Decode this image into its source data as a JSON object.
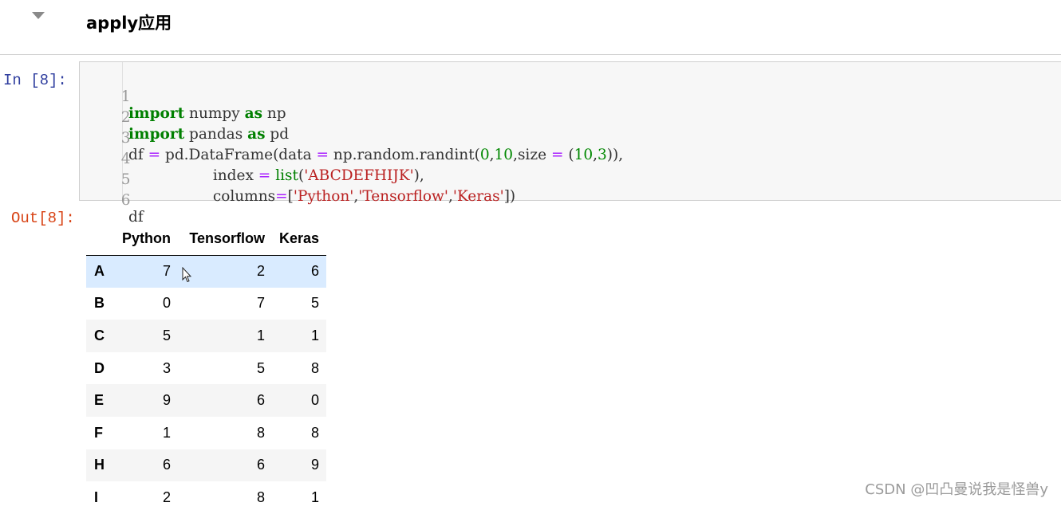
{
  "markdown": {
    "heading": "apply应用"
  },
  "cell": {
    "in_prompt": "In  [8]:",
    "out_prompt": "Out[8]:",
    "code": {
      "line_numbers": [
        "1",
        "2",
        "3",
        "4",
        "5",
        "6"
      ]
    }
  },
  "dataframe": {
    "columns": [
      "Python",
      "Tensorflow",
      "Keras"
    ],
    "rows": [
      {
        "index": "A",
        "values": [
          "7",
          "2",
          "6"
        ]
      },
      {
        "index": "B",
        "values": [
          "0",
          "7",
          "5"
        ]
      },
      {
        "index": "C",
        "values": [
          "5",
          "1",
          "1"
        ]
      },
      {
        "index": "D",
        "values": [
          "3",
          "5",
          "8"
        ]
      },
      {
        "index": "E",
        "values": [
          "9",
          "6",
          "0"
        ]
      },
      {
        "index": "F",
        "values": [
          "1",
          "8",
          "8"
        ]
      },
      {
        "index": "H",
        "values": [
          "6",
          "6",
          "9"
        ]
      },
      {
        "index": "I",
        "values": [
          "2",
          "8",
          "1"
        ]
      }
    ],
    "hover_row": "A"
  },
  "watermark": "CSDN @凹凸曼说我是怪兽y",
  "colors": {
    "in_prompt": "#303f9f",
    "out_prompt": "#d84315",
    "keyword": "#008000",
    "string": "#ba2121",
    "hover_row": "#d9ebff"
  }
}
